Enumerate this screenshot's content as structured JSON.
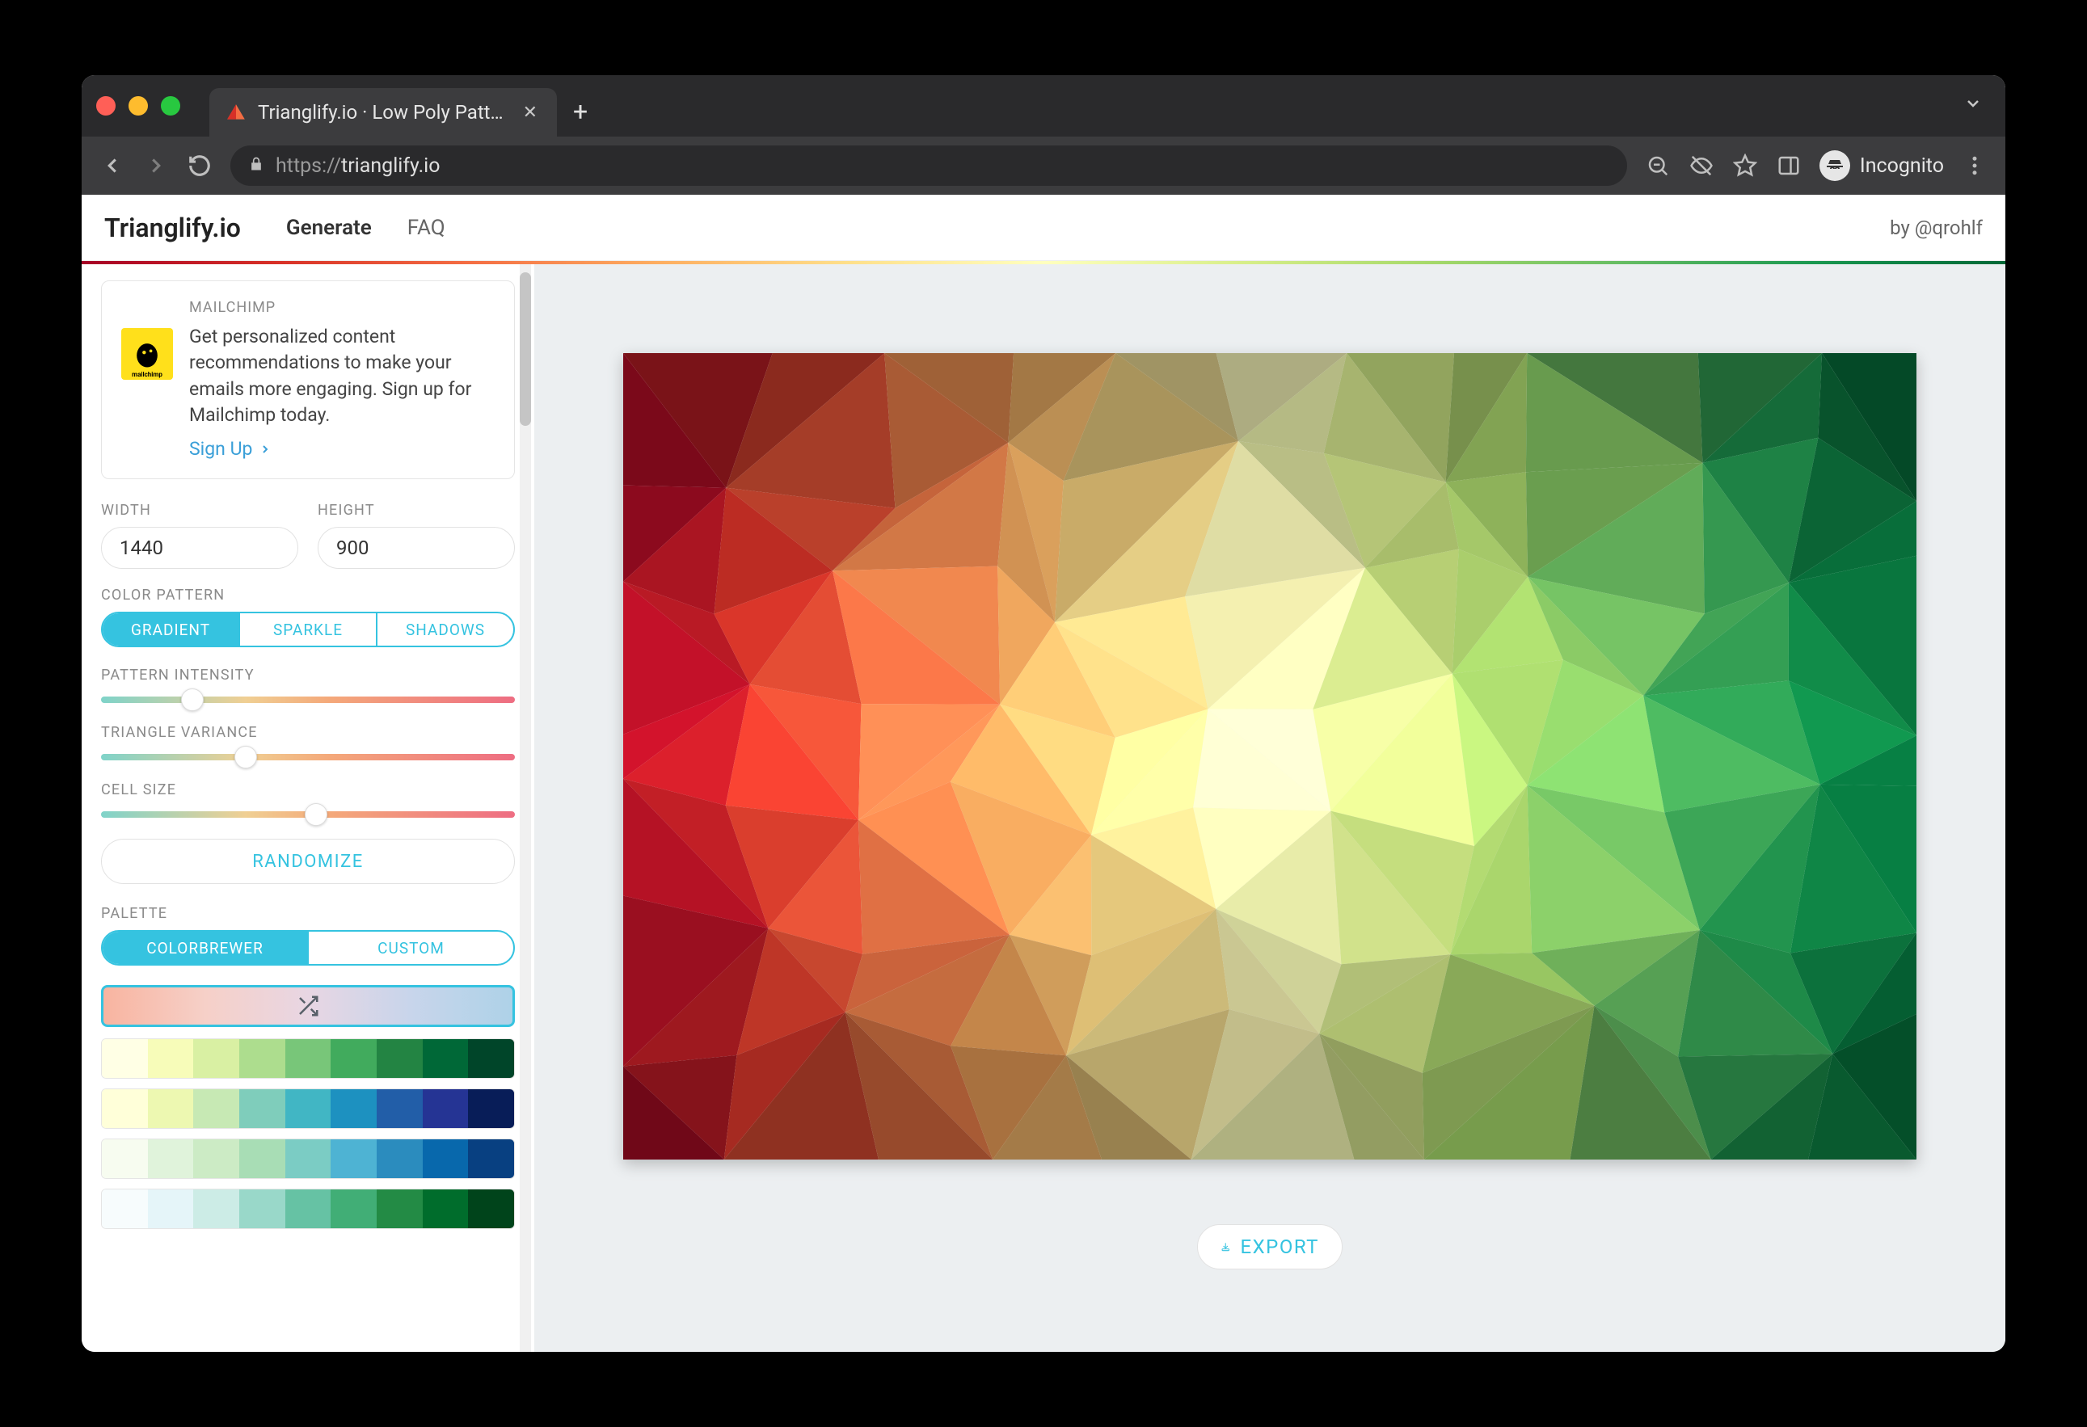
{
  "browser": {
    "tab_title": "Trianglify.io · Low Poly Pattern",
    "url_scheme": "https://",
    "url_host": "trianglify.io",
    "incognito_label": "Incognito"
  },
  "header": {
    "brand": "Trianglify.io",
    "nav": [
      {
        "label": "Generate",
        "active": true
      },
      {
        "label": "FAQ",
        "active": false
      }
    ],
    "credit": "by @qrohlf"
  },
  "sidebar": {
    "ad": {
      "sponsor": "MAILCHIMP",
      "text": "Get personalized content recommendations to make your emails more engaging. Sign up for Mailchimp today.",
      "cta": "Sign Up",
      "logo_caption": "mailchimp"
    },
    "width": {
      "label": "WIDTH",
      "value": "1440"
    },
    "height": {
      "label": "HEIGHT",
      "value": "900"
    },
    "color_pattern": {
      "label": "COLOR PATTERN",
      "options": [
        "GRADIENT",
        "SPARKLE",
        "SHADOWS"
      ],
      "selected": "GRADIENT"
    },
    "pattern_intensity": {
      "label": "PATTERN INTENSITY",
      "value_pct": 22
    },
    "triangle_variance": {
      "label": "TRIANGLE VARIANCE",
      "value_pct": 35
    },
    "cell_size": {
      "label": "CELL SIZE",
      "value_pct": 52
    },
    "randomize_label": "RANDOMIZE",
    "palette": {
      "label": "PALETTE",
      "options": [
        "COLORBREWER",
        "CUSTOM"
      ],
      "selected": "COLORBREWER",
      "rows": [
        [
          "#ffffe5",
          "#f7fcb9",
          "#d9f0a3",
          "#addd8e",
          "#78c679",
          "#41ab5d",
          "#238443",
          "#006837",
          "#004529"
        ],
        [
          "#ffffd9",
          "#edf8b1",
          "#c7e9b4",
          "#7fcdbb",
          "#41b6c4",
          "#1d91c0",
          "#225ea8",
          "#253494",
          "#081d58"
        ],
        [
          "#f7fcf0",
          "#e0f3db",
          "#ccebc5",
          "#a8ddb5",
          "#7bccc4",
          "#4eb3d3",
          "#2b8cbe",
          "#0868ac",
          "#084081"
        ],
        [
          "#f7fcfd",
          "#e5f5f9",
          "#ccece6",
          "#99d8c9",
          "#66c2a4",
          "#41ae76",
          "#238b45",
          "#006d2c",
          "#00441b"
        ]
      ]
    }
  },
  "export_label": "EXPORT",
  "pattern": {
    "gradient_colors": [
      "#a50026",
      "#d73027",
      "#f46d43",
      "#fdae61",
      "#fee08b",
      "#ffffbf",
      "#d9ef8b",
      "#a6d96a",
      "#66bd63",
      "#1a9850",
      "#006837"
    ]
  }
}
